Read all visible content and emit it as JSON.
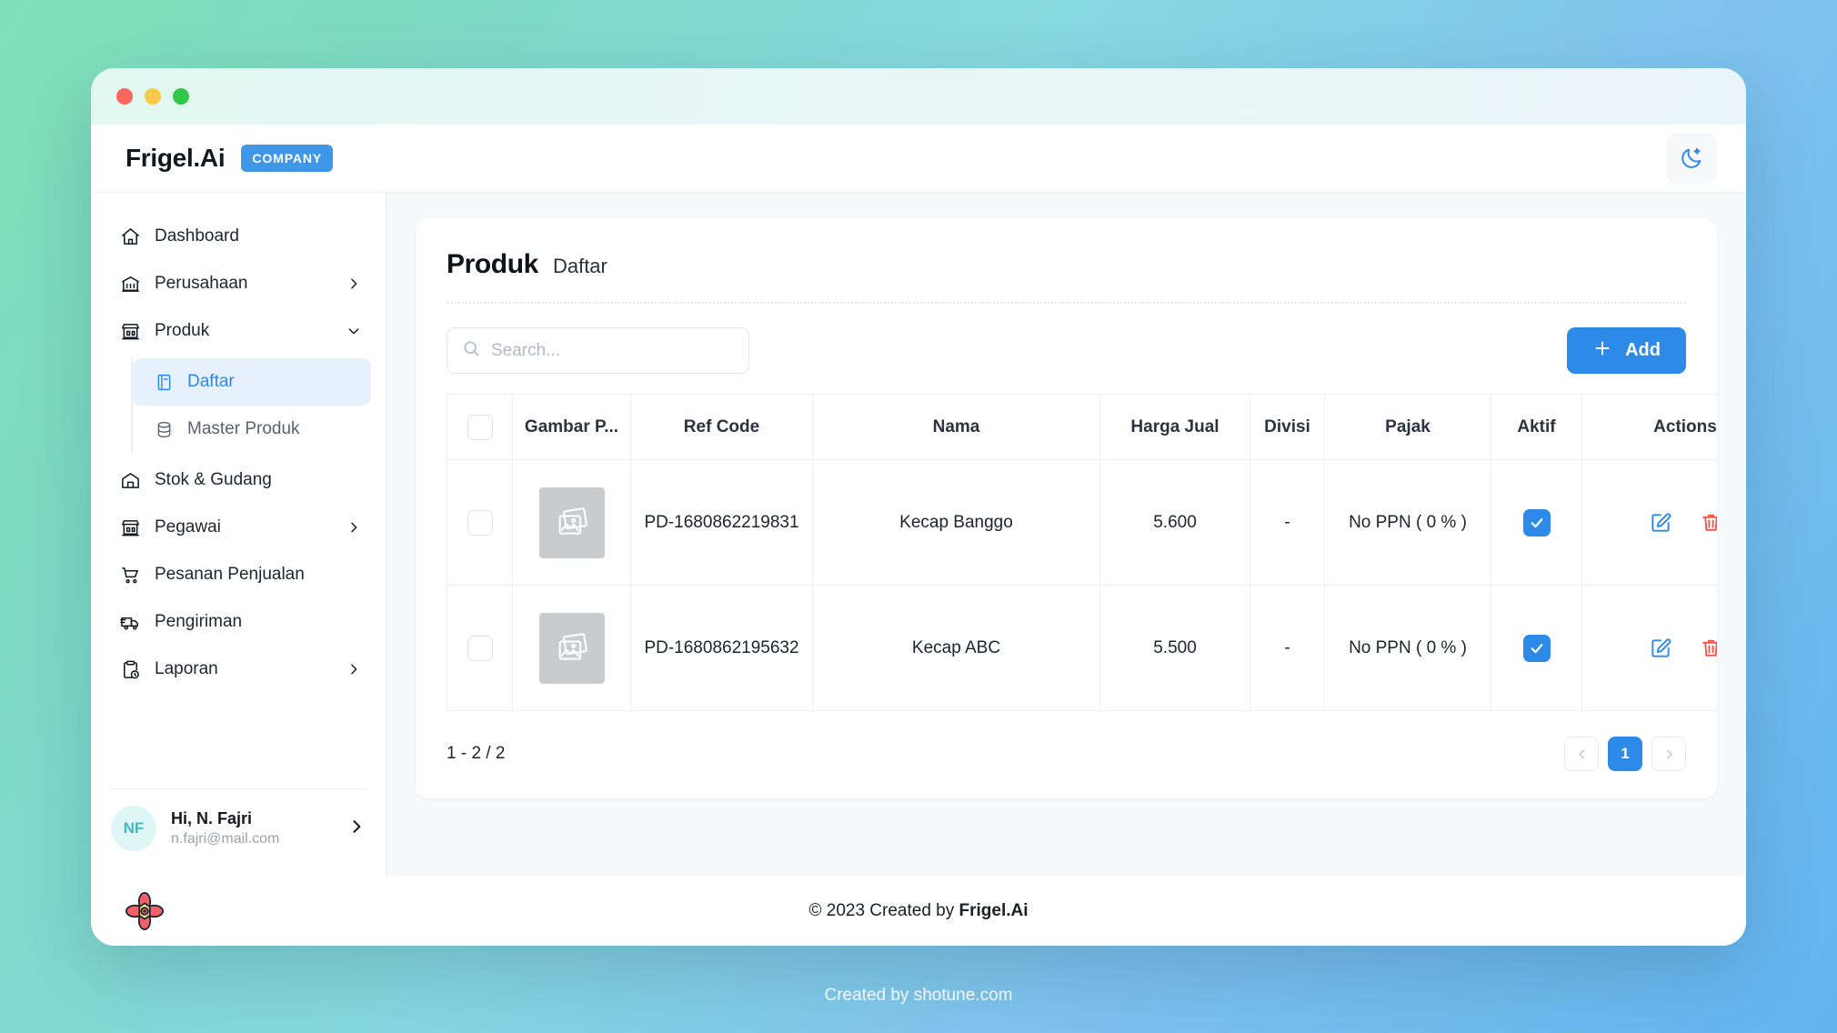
{
  "window": {
    "traffic_lights": [
      "close",
      "minimize",
      "maximize"
    ]
  },
  "topbar": {
    "brand": "Frigel.Ai",
    "badge": "COMPANY",
    "theme_toggle_icon": "moon-icon"
  },
  "sidebar": {
    "items": [
      {
        "label": "Dashboard",
        "icon": "home-icon",
        "has_chevron": false,
        "active": false
      },
      {
        "label": "Perusahaan",
        "icon": "bank-icon",
        "has_chevron": true,
        "active": false
      },
      {
        "label": "Produk",
        "icon": "store-icon",
        "has_chevron": true,
        "expanded": true,
        "active": false
      },
      {
        "label": "Stok & Gudang",
        "icon": "warehouse-icon",
        "has_chevron": false,
        "active": false
      },
      {
        "label": "Pegawai",
        "icon": "store-icon",
        "has_chevron": true,
        "active": false
      },
      {
        "label": "Pesanan Penjualan",
        "icon": "cart-icon",
        "has_chevron": false,
        "active": false
      },
      {
        "label": "Pengiriman",
        "icon": "truck-icon",
        "has_chevron": false,
        "active": false
      },
      {
        "label": "Laporan",
        "icon": "clipboard-clock-icon",
        "has_chevron": true,
        "active": false
      }
    ],
    "subitems": [
      {
        "label": "Daftar",
        "icon": "book-icon",
        "active": true
      },
      {
        "label": "Master Produk",
        "icon": "database-icon",
        "active": false
      }
    ],
    "profile": {
      "initials": "NF",
      "greeting": "Hi, N. Fajri",
      "email": "n.fajri@mail.com",
      "chevron_icon": "chevron-right-icon"
    }
  },
  "main": {
    "title": "Produk",
    "subtitle": "Daftar",
    "search": {
      "placeholder": "Search...",
      "value": "",
      "icon": "search-icon"
    },
    "add_button": {
      "label": "Add",
      "icon": "plus-icon"
    },
    "table": {
      "columns": [
        "",
        "Gambar P...",
        "Ref Code",
        "Nama",
        "Harga Jual",
        "Divisi",
        "Pajak",
        "Aktif",
        "Actions"
      ],
      "rows": [
        {
          "selected": false,
          "image": "image-placeholder-icon",
          "ref_code": "PD-1680862219831",
          "nama": "Kecap Banggo",
          "harga_jual": "5.600",
          "divisi": "-",
          "pajak": "No PPN ( 0 % )",
          "aktif": true
        },
        {
          "selected": false,
          "image": "image-placeholder-icon",
          "ref_code": "PD-1680862195632",
          "nama": "Kecap ABC",
          "harga_jual": "5.500",
          "divisi": "-",
          "pajak": "No PPN ( 0 % )",
          "aktif": true
        }
      ]
    },
    "pagination": {
      "range_text": "1 - 2 / 2",
      "prev_icon": "chevron-left-icon",
      "next_icon": "chevron-right-icon",
      "current_page": "1"
    }
  },
  "footer": {
    "logo_icon": "flower-logo-icon",
    "copyright_prefix": "© 2023 Created by ",
    "copyright_brand": "Frigel.Ai"
  },
  "watermark": "Created by shotune.com",
  "colors": {
    "accent_blue": "#2d8ae8",
    "badge_blue": "#3f97e8",
    "active_nav_bg": "#e6f1fd",
    "active_nav_text": "#2d87e8",
    "delete_red": "#f5534a",
    "avatar_bg": "#dff6f7",
    "avatar_text": "#3fb8c4"
  }
}
